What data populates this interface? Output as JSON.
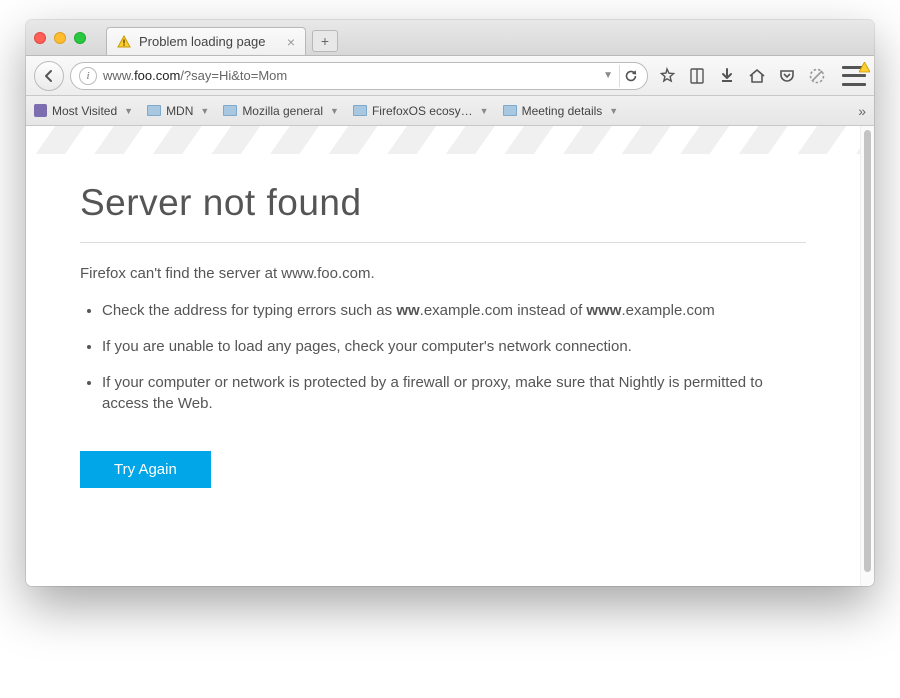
{
  "window": {
    "tab_title": "Problem loading page"
  },
  "urlbar": {
    "protocol_prefix": "www.",
    "host": "foo.com",
    "path": "/?say=Hi&to=Mom"
  },
  "bookmarks": {
    "most_visited": "Most Visited",
    "items": [
      "MDN",
      "Mozilla general",
      "FirefoxOS ecosy…",
      "Meeting details"
    ]
  },
  "error": {
    "title": "Server not found",
    "lead_prefix": "Firefox can't find the server at ",
    "lead_host": "www.foo.com",
    "lead_suffix": ".",
    "bullet1_a": "Check the address for typing errors such as ",
    "bullet1_bold1": "ww",
    "bullet1_b": ".example.com instead of ",
    "bullet1_bold2": "www",
    "bullet1_c": ".example.com",
    "bullet2": "If you are unable to load any pages, check your computer's network connection.",
    "bullet3": "If your computer or network is protected by a firewall or proxy, make sure that Nightly is permitted to access the Web.",
    "try_again": "Try Again"
  }
}
